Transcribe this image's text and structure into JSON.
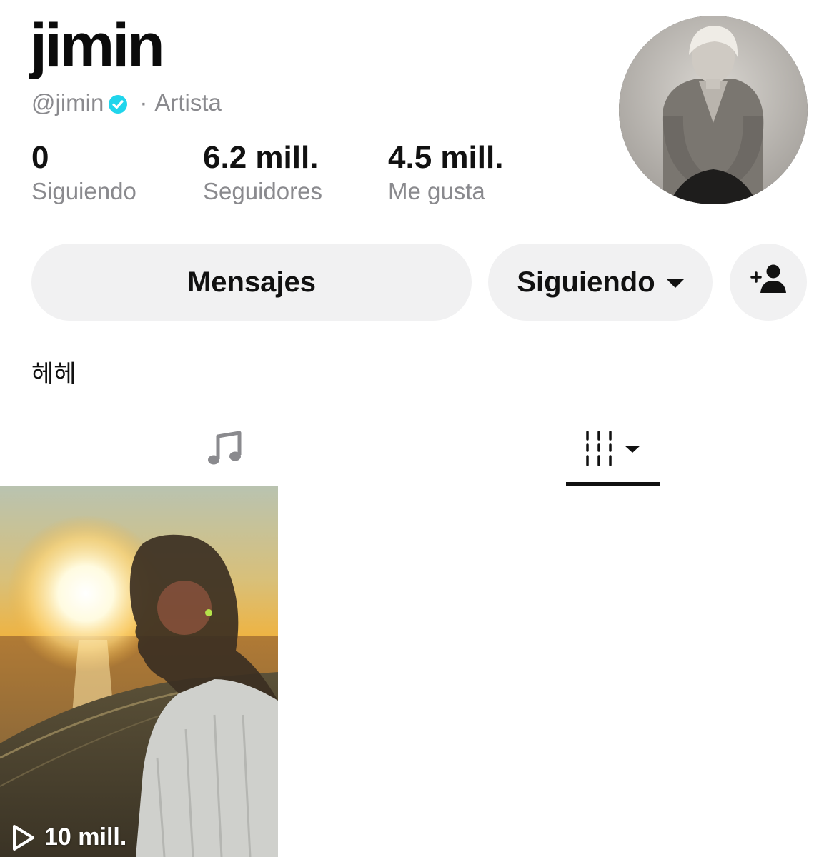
{
  "profile": {
    "display_name": "jimin",
    "handle": "@jimin",
    "separator": "·",
    "category": "Artista",
    "bio": "헤헤"
  },
  "stats": [
    {
      "value": "0",
      "label": "Siguiendo"
    },
    {
      "value": "6.2 mill.",
      "label": "Seguidores"
    },
    {
      "value": "4.5 mill.",
      "label": "Me gusta"
    }
  ],
  "actions": {
    "message_label": "Mensajes",
    "following_label": "Siguiendo"
  },
  "tabs": {
    "music_icon": "music-note-icon",
    "grid_icon": "video-grid-icon",
    "active": "videos"
  },
  "videos": [
    {
      "views": "10 mill."
    }
  ],
  "colors": {
    "verified": "#20d5ec",
    "muted_text": "#8a8a8e",
    "button_bg": "#f1f1f2"
  }
}
